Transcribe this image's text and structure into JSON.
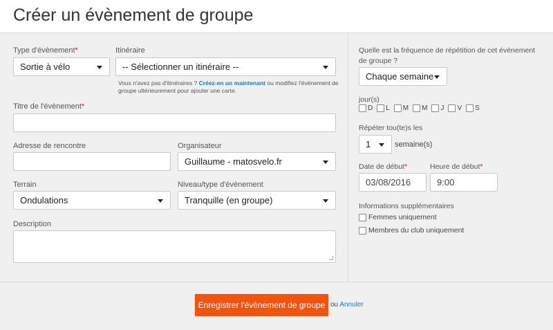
{
  "page_title": "Créer un évènement de groupe",
  "colors": {
    "accent": "#f25410",
    "link": "#1a7ab8",
    "required": "#dd0044"
  },
  "event_type": {
    "label": "Type d'évènement",
    "required_mark": "*",
    "value": "Sortie à vélo"
  },
  "itinerary": {
    "label": "Itinéraire",
    "value": "-- Sélectionner un itinéraire --",
    "help_prefix": "Vous n'avez pas d'itinéraires ? ",
    "help_link": "Créez-en un maintenant",
    "help_suffix": " ou modifiez l'évènement de groupe ultérieurement pour ajouter une carte."
  },
  "event_title": {
    "label": "Titre de l'évènement",
    "required_mark": "*",
    "value": ""
  },
  "meeting_address": {
    "label": "Adresse de rencontre",
    "value": ""
  },
  "organizer": {
    "label": "Organisateur",
    "value": "Guillaume - matosvelo.fr"
  },
  "terrain": {
    "label": "Terrain",
    "value": "Ondulations"
  },
  "level": {
    "label": "Niveau/type d'évènement",
    "value": "Tranquille (en groupe)"
  },
  "description": {
    "label": "Description",
    "value": ""
  },
  "frequency": {
    "label": "Quelle est la fréquence de répétition de cet évènement de groupe ?",
    "value": "Chaque semaine"
  },
  "days": {
    "label": "jour(s)",
    "items": [
      "D",
      "L",
      "M",
      "M",
      "J",
      "V",
      "S"
    ]
  },
  "repeat": {
    "label": "Répéter tou(te)s les",
    "value": "1",
    "unit": "semaine(s)"
  },
  "start_date": {
    "label": "Date de début",
    "required_mark": "*",
    "value": "03/08/2016"
  },
  "start_time": {
    "label": "Heure de début",
    "required_mark": "*",
    "value": "9:00"
  },
  "extra_info": {
    "label": "Informations supplémentaires",
    "women_only": "Femmes uniquement",
    "club_members_only": "Membres du club uniquement"
  },
  "footer": {
    "save_label": "Enregistrer l'évènement de groupe",
    "or_text": "ou",
    "cancel_label": "Annuler"
  }
}
